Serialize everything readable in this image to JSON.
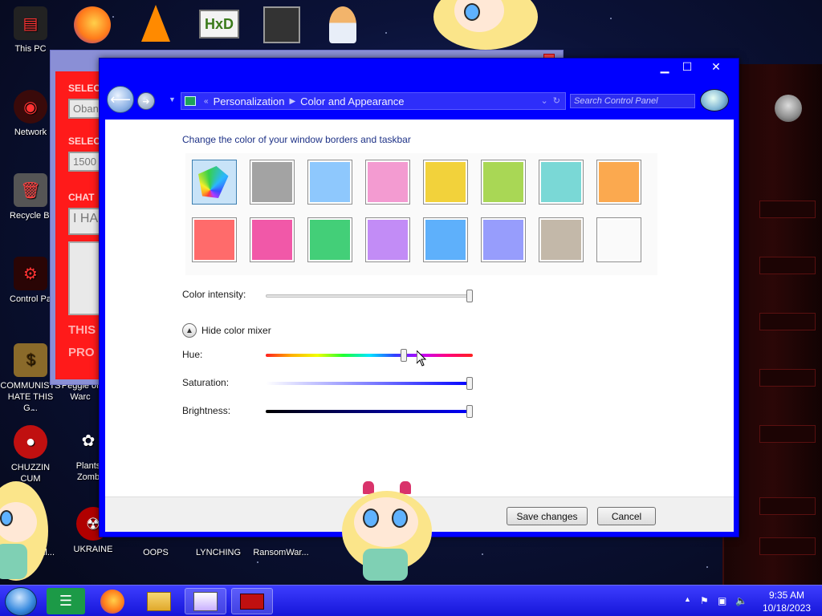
{
  "desktop": {
    "icons": [
      {
        "label": "This PC"
      },
      {
        "label": "Network"
      },
      {
        "label": "Recycle Bi"
      },
      {
        "label": "Control Pa"
      },
      {
        "label": "COMMUNISTS HATE THIS G..."
      },
      {
        "label": "Peggle of Warc"
      },
      {
        "label": "CHUZZIN CUM"
      },
      {
        "label": "Plants Zomb"
      },
      {
        "label": "ad All..."
      },
      {
        "label": "UKRAINE"
      },
      {
        "label": "OOPS"
      },
      {
        "label": "LYNCHING"
      },
      {
        "label": "RansomWar..."
      }
    ]
  },
  "background_window": {
    "labels": [
      "SELEC",
      "SELEC",
      "CHAT"
    ],
    "fields": [
      "Oban",
      "1500",
      "I HA"
    ],
    "text_lines": [
      "THIS",
      "PRO"
    ]
  },
  "window": {
    "controls": {
      "minimize": "▁",
      "maximize": "☐",
      "close": "✕"
    }
  },
  "address_bar": {
    "breadcrumbs": [
      "Personalization",
      "Color and Appearance"
    ],
    "left_sep": "«"
  },
  "search": {
    "placeholder": "Search Control Panel"
  },
  "content": {
    "heading": "Change the color of your window borders and taskbar",
    "swatches": [
      {
        "name": "custom",
        "color": "#ffffff",
        "selected": true
      },
      {
        "name": "slate",
        "color": "#a3a3a3"
      },
      {
        "name": "sky",
        "color": "#8ec8fd"
      },
      {
        "name": "twilight",
        "color": "#f39bd1"
      },
      {
        "name": "sea-foam-yellow",
        "color": "#f2d23b"
      },
      {
        "name": "leaf",
        "color": "#a9d755"
      },
      {
        "name": "lime",
        "color": "#7ad8d6"
      },
      {
        "name": "pumpkin",
        "color": "#fba94f"
      },
      {
        "name": "ruby",
        "color": "#ff6b6b"
      },
      {
        "name": "fuchsia",
        "color": "#f158a8"
      },
      {
        "name": "green",
        "color": "#43cf78"
      },
      {
        "name": "violet",
        "color": "#c28cf6"
      },
      {
        "name": "blue",
        "color": "#5eb0fb"
      },
      {
        "name": "lavender",
        "color": "#979dfc"
      },
      {
        "name": "taupe",
        "color": "#c3b8a9"
      },
      {
        "name": "frost",
        "color": "#fafafa"
      }
    ],
    "intensity_label": "Color intensity:",
    "intensity_value": 1.0,
    "mixer_toggle_label": "Hide color mixer",
    "hue_label": "Hue:",
    "hue_value": 0.67,
    "saturation_label": "Saturation:",
    "saturation_value": 1.0,
    "brightness_label": "Brightness:",
    "brightness_value": 1.0
  },
  "footer": {
    "save_label": "Save changes",
    "cancel_label": "Cancel"
  },
  "taskbar": {
    "time": "9:35 AM",
    "date": "10/18/2023"
  },
  "colors": {
    "window_frame": "#0000ff",
    "taskbar": "#2626ea",
    "heading": "#1e3287"
  }
}
